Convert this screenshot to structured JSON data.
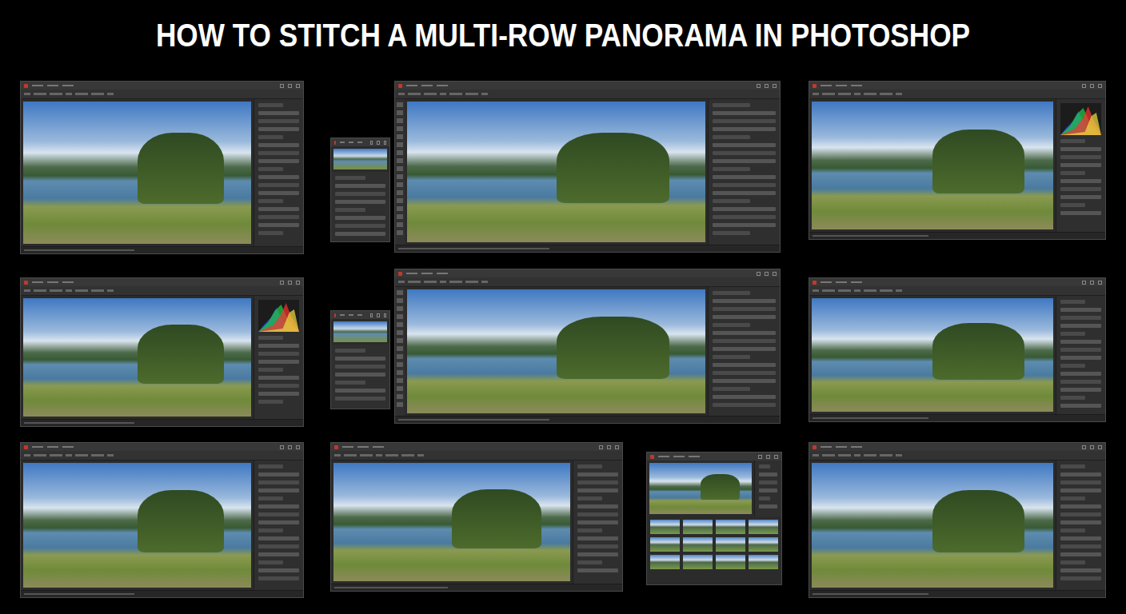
{
  "title": "HOW TO STITCH A MULTI-ROW PANORAMA IN PHOTOSHOP",
  "windows": [
    {
      "kind": "editor"
    },
    {
      "kind": "panel"
    },
    {
      "kind": "editor"
    },
    {
      "kind": "editor-histogram"
    },
    {
      "kind": "editor-histogram"
    },
    {
      "kind": "panel"
    },
    {
      "kind": "editor"
    },
    {
      "kind": "editor"
    },
    {
      "kind": "editor"
    },
    {
      "kind": "editor"
    },
    {
      "kind": "filmstrip"
    },
    {
      "kind": "editor"
    }
  ]
}
